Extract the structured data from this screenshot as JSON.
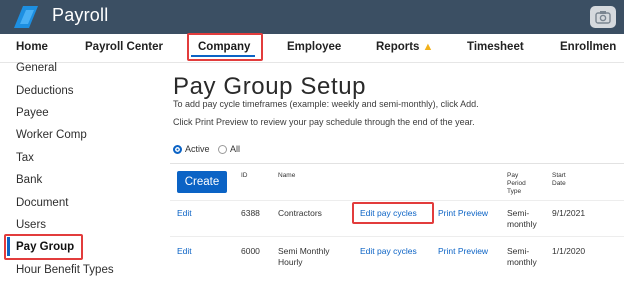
{
  "app": {
    "title": "Payroll"
  },
  "nav": {
    "items": [
      "Home",
      "Payroll Center",
      "Company",
      "Employee",
      "Reports",
      "Timesheet",
      "Enrollmen"
    ],
    "active": "Company"
  },
  "sidebar": {
    "items": [
      "General",
      "Deductions",
      "Payee",
      "Worker Comp",
      "Tax",
      "Bank",
      "Document",
      "Users",
      "Pay Group",
      "Hour Benefit Types"
    ],
    "active": "Pay Group"
  },
  "main": {
    "title": "Pay Group Setup",
    "desc1": "To add pay cycle timeframes (example: weekly and semi-monthly), click Add.",
    "desc2": "Click Print Preview to review your pay schedule through the end of the year.",
    "filter": {
      "active_label": "Active",
      "all_label": "All",
      "selected": "Active"
    },
    "create_label": "Create"
  },
  "table": {
    "headers": {
      "id": "ID",
      "name": "Name",
      "pay_period_type": "Pay\nPeriod\nType",
      "start_date": "Start\nDate"
    },
    "rows": [
      {
        "edit": "Edit",
        "id": "6388",
        "name": "Contractors",
        "edit_cycles": "Edit pay cycles",
        "print": "Print Preview",
        "type": "Semi-\nmonthly",
        "start": "9/1/2021"
      },
      {
        "edit": "Edit",
        "id": "6000",
        "name": "Semi Monthly\nHourly",
        "edit_cycles": "Edit pay cycles",
        "print": "Print Preview",
        "type": "Semi-\nmonthly",
        "start": "1/1/2020"
      }
    ]
  },
  "colors": {
    "topbar": "#3b4f63",
    "accent": "#0b63c5",
    "highlight": "#e23c3c",
    "warning": "#f2b11a"
  },
  "icons": {
    "logo": "payroll-logo",
    "camera": "camera-icon",
    "reports_warning": "warning-icon"
  }
}
